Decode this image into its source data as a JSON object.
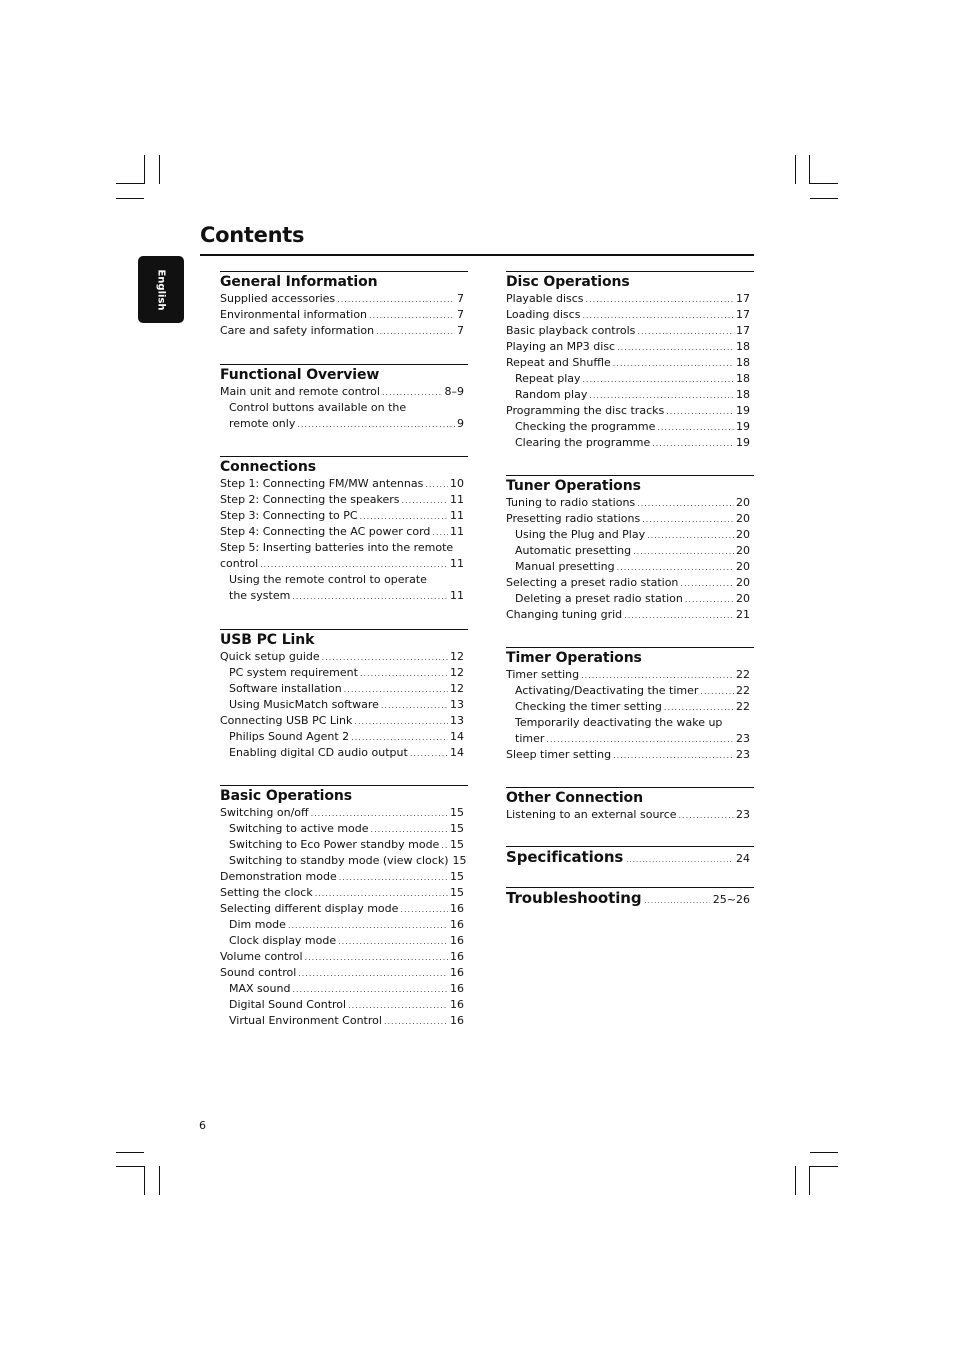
{
  "page": {
    "title": "Contents",
    "language_tab": "English",
    "page_number": "6"
  },
  "left_column": [
    {
      "title": "General Information",
      "entries": [
        {
          "label": "Supplied accessories",
          "page": "7",
          "level": 0
        },
        {
          "label": "Environmental information",
          "page": "7",
          "level": 0
        },
        {
          "label": "Care and safety information",
          "page": "7",
          "level": 0
        }
      ]
    },
    {
      "title": "Functional Overview",
      "entries": [
        {
          "label": "Main unit and remote control",
          "page": "8–9",
          "level": 0
        },
        {
          "label": "Control buttons available on the",
          "page": "",
          "level": 1
        },
        {
          "label": "remote only",
          "page": "9",
          "level": 1
        }
      ]
    },
    {
      "title": "Connections",
      "entries": [
        {
          "label": "Step 1: Connecting FM/MW antennas",
          "page": "10",
          "level": 0
        },
        {
          "label": "Step 2: Connecting the speakers",
          "page": "11",
          "level": 0
        },
        {
          "label": "Step 3: Connecting to PC",
          "page": "11",
          "level": 0
        },
        {
          "label": "Step 4: Connecting the AC power cord",
          "page": "11",
          "level": 0
        },
        {
          "label": "Step 5: Inserting batteries into the remote",
          "page": "",
          "level": 0
        },
        {
          "label": "control",
          "page": "11",
          "level": 0
        },
        {
          "label": "Using the remote control to operate",
          "page": "",
          "level": 1
        },
        {
          "label": "the system",
          "page": "11",
          "level": 1
        }
      ]
    },
    {
      "title": "USB PC Link",
      "entries": [
        {
          "label": "Quick setup guide",
          "page": "12",
          "level": 0
        },
        {
          "label": "PC system requirement",
          "page": "12",
          "level": 1
        },
        {
          "label": "Software installation",
          "page": "12",
          "level": 1
        },
        {
          "label": "Using MusicMatch software",
          "page": "13",
          "level": 1
        },
        {
          "label": "Connecting USB PC Link",
          "page": "13",
          "level": 0
        },
        {
          "label": "Philips Sound Agent 2",
          "page": "14",
          "level": 1
        },
        {
          "label": "Enabling digital CD audio output",
          "page": "14",
          "level": 1
        }
      ]
    },
    {
      "title": "Basic Operations",
      "entries": [
        {
          "label": "Switching on/off",
          "page": "15",
          "level": 0
        },
        {
          "label": "Switching to active mode",
          "page": "15",
          "level": 1
        },
        {
          "label": "Switching to Eco Power standby mode",
          "page": "15",
          "level": 1
        },
        {
          "label": "Switching to standby mode (view clock)",
          "page": "15",
          "level": 1
        },
        {
          "label": "Demonstration mode",
          "page": "15",
          "level": 0
        },
        {
          "label": "Setting the clock",
          "page": "15",
          "level": 0
        },
        {
          "label": "Selecting different display mode",
          "page": "16",
          "level": 0
        },
        {
          "label": "Dim mode",
          "page": "16",
          "level": 1
        },
        {
          "label": "Clock display mode",
          "page": "16",
          "level": 1
        },
        {
          "label": "Volume control",
          "page": "16",
          "level": 0
        },
        {
          "label": "Sound control",
          "page": "16",
          "level": 0
        },
        {
          "label": "MAX sound",
          "page": "16",
          "level": 1
        },
        {
          "label": "Digital Sound Control",
          "page": "16",
          "level": 1
        },
        {
          "label": "Virtual Environment Control",
          "page": "16",
          "level": 1
        }
      ]
    }
  ],
  "right_column": [
    {
      "title": "Disc Operations",
      "entries": [
        {
          "label": "Playable discs",
          "page": "17",
          "level": 0
        },
        {
          "label": "Loading discs",
          "page": "17",
          "level": 0
        },
        {
          "label": "Basic playback controls",
          "page": "17",
          "level": 0
        },
        {
          "label": "Playing an MP3 disc",
          "page": "18",
          "level": 0
        },
        {
          "label": "Repeat and Shuffle",
          "page": "18",
          "level": 0
        },
        {
          "label": "Repeat play",
          "page": "18",
          "level": 1
        },
        {
          "label": "Random play",
          "page": "18",
          "level": 1
        },
        {
          "label": "Programming the disc tracks",
          "page": "19",
          "level": 0
        },
        {
          "label": "Checking the programme",
          "page": "19",
          "level": 1
        },
        {
          "label": "Clearing the programme",
          "page": "19",
          "level": 1
        }
      ]
    },
    {
      "title": "Tuner Operations",
      "entries": [
        {
          "label": "Tuning to radio stations",
          "page": "20",
          "level": 0
        },
        {
          "label": "Presetting radio stations",
          "page": "20",
          "level": 0
        },
        {
          "label": "Using the Plug and Play",
          "page": "20",
          "level": 1
        },
        {
          "label": "Automatic presetting",
          "page": "20",
          "level": 1
        },
        {
          "label": "Manual presetting",
          "page": "20",
          "level": 1
        },
        {
          "label": "Selecting a preset radio station",
          "page": "20",
          "level": 0
        },
        {
          "label": "Deleting a preset radio station",
          "page": "20",
          "level": 1
        },
        {
          "label": "Changing tuning grid",
          "page": "21",
          "level": 0
        }
      ]
    },
    {
      "title": "Timer Operations",
      "entries": [
        {
          "label": "Timer setting",
          "page": "22",
          "level": 0
        },
        {
          "label": "Activating/Deactivating the timer",
          "page": "22",
          "level": 1
        },
        {
          "label": "Checking the timer setting",
          "page": "22",
          "level": 1
        },
        {
          "label": "Temporarily deactivating the wake up",
          "page": "",
          "level": 1
        },
        {
          "label": "timer",
          "page": "23",
          "level": 1
        },
        {
          "label": "Sleep timer setting",
          "page": "23",
          "level": 0
        }
      ]
    },
    {
      "title": "Other Connection",
      "entries": [
        {
          "label": "Listening to an external source",
          "page": "23",
          "level": 0
        }
      ]
    }
  ],
  "inline_sections": [
    {
      "title": "Specifications",
      "page": "24"
    },
    {
      "title": "Troubleshooting",
      "page": "25~26"
    }
  ]
}
